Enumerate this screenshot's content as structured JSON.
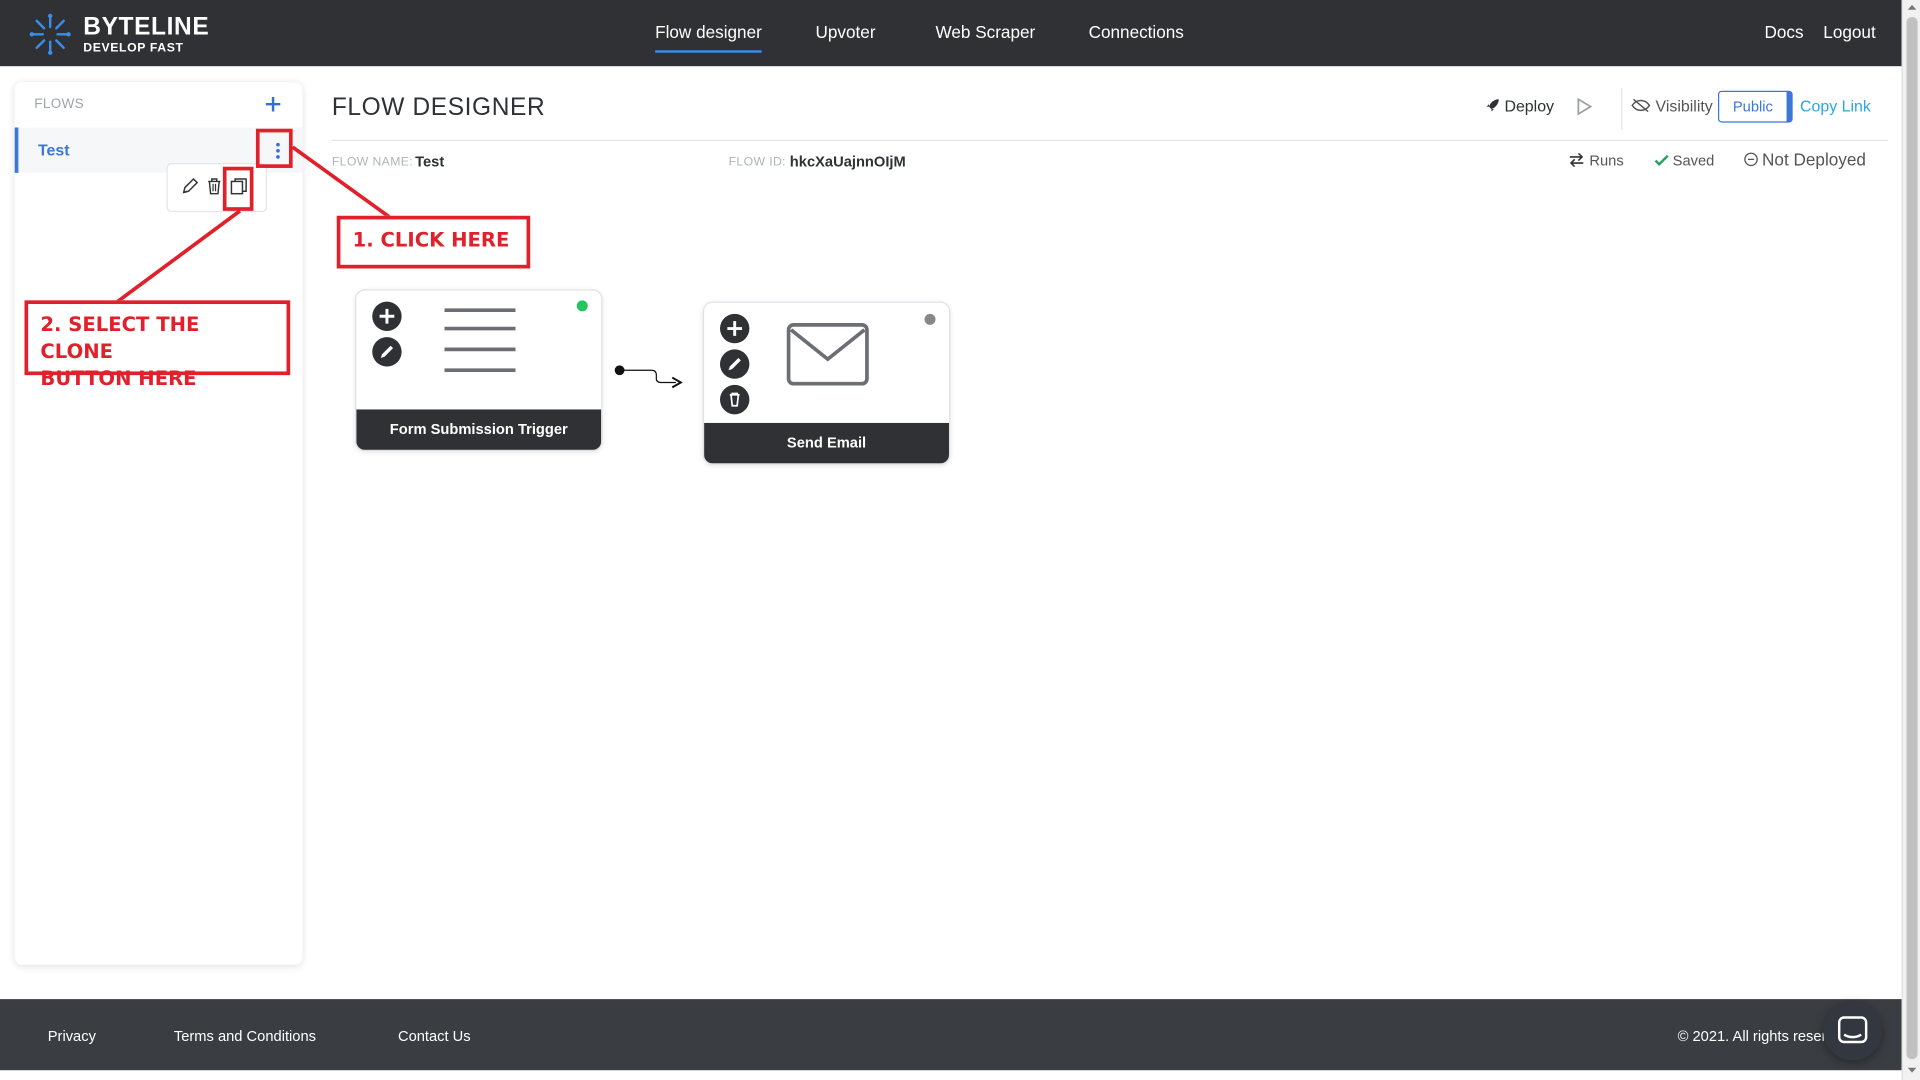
{
  "brand": {
    "name": "BYTELINE",
    "tagline": "DEVELOP FAST",
    "accent": "#3a8ee6"
  },
  "nav": {
    "items": [
      "Flow designer",
      "Upvoter",
      "Web Scraper",
      "Connections"
    ],
    "active": "Flow designer",
    "right": [
      "Docs",
      "Logout"
    ]
  },
  "sidebar": {
    "title": "FLOWS",
    "add_icon": "plus-icon",
    "flows": [
      {
        "name": "Test",
        "selected": true
      }
    ],
    "row_actions": [
      "pencil-icon",
      "trash-icon",
      "clone-icon"
    ]
  },
  "header": {
    "title": "FLOW DESIGNER",
    "deploy_label": "Deploy",
    "visibility_label": "Visibility",
    "public_label": "Public",
    "copy_link_label": "Copy Link"
  },
  "meta": {
    "flow_name_label": "FLOW NAME:",
    "flow_name": "Test",
    "flow_id_label": "FLOW ID:",
    "flow_id": "hkcXaUajnnOIjM",
    "runs_label": "Runs",
    "saved_label": "Saved",
    "deploy_status": "Not Deployed"
  },
  "nodes": [
    {
      "title": "Form Submission Trigger",
      "icon": "form-lines-icon",
      "status_color": "#22c55e"
    },
    {
      "title": "Send Email",
      "icon": "envelope-icon",
      "status_color": "#888888"
    }
  ],
  "annotations": {
    "step1": "1. CLICK HERE",
    "step2_line1": "2. SELECT THE CLONE",
    "step2_line2": "BUTTON HERE",
    "color": "#e0212b"
  },
  "footer": {
    "links": [
      "Privacy",
      "Terms and Conditions",
      "Contact Us"
    ],
    "copyright": "© 2021. All rights reserved"
  }
}
